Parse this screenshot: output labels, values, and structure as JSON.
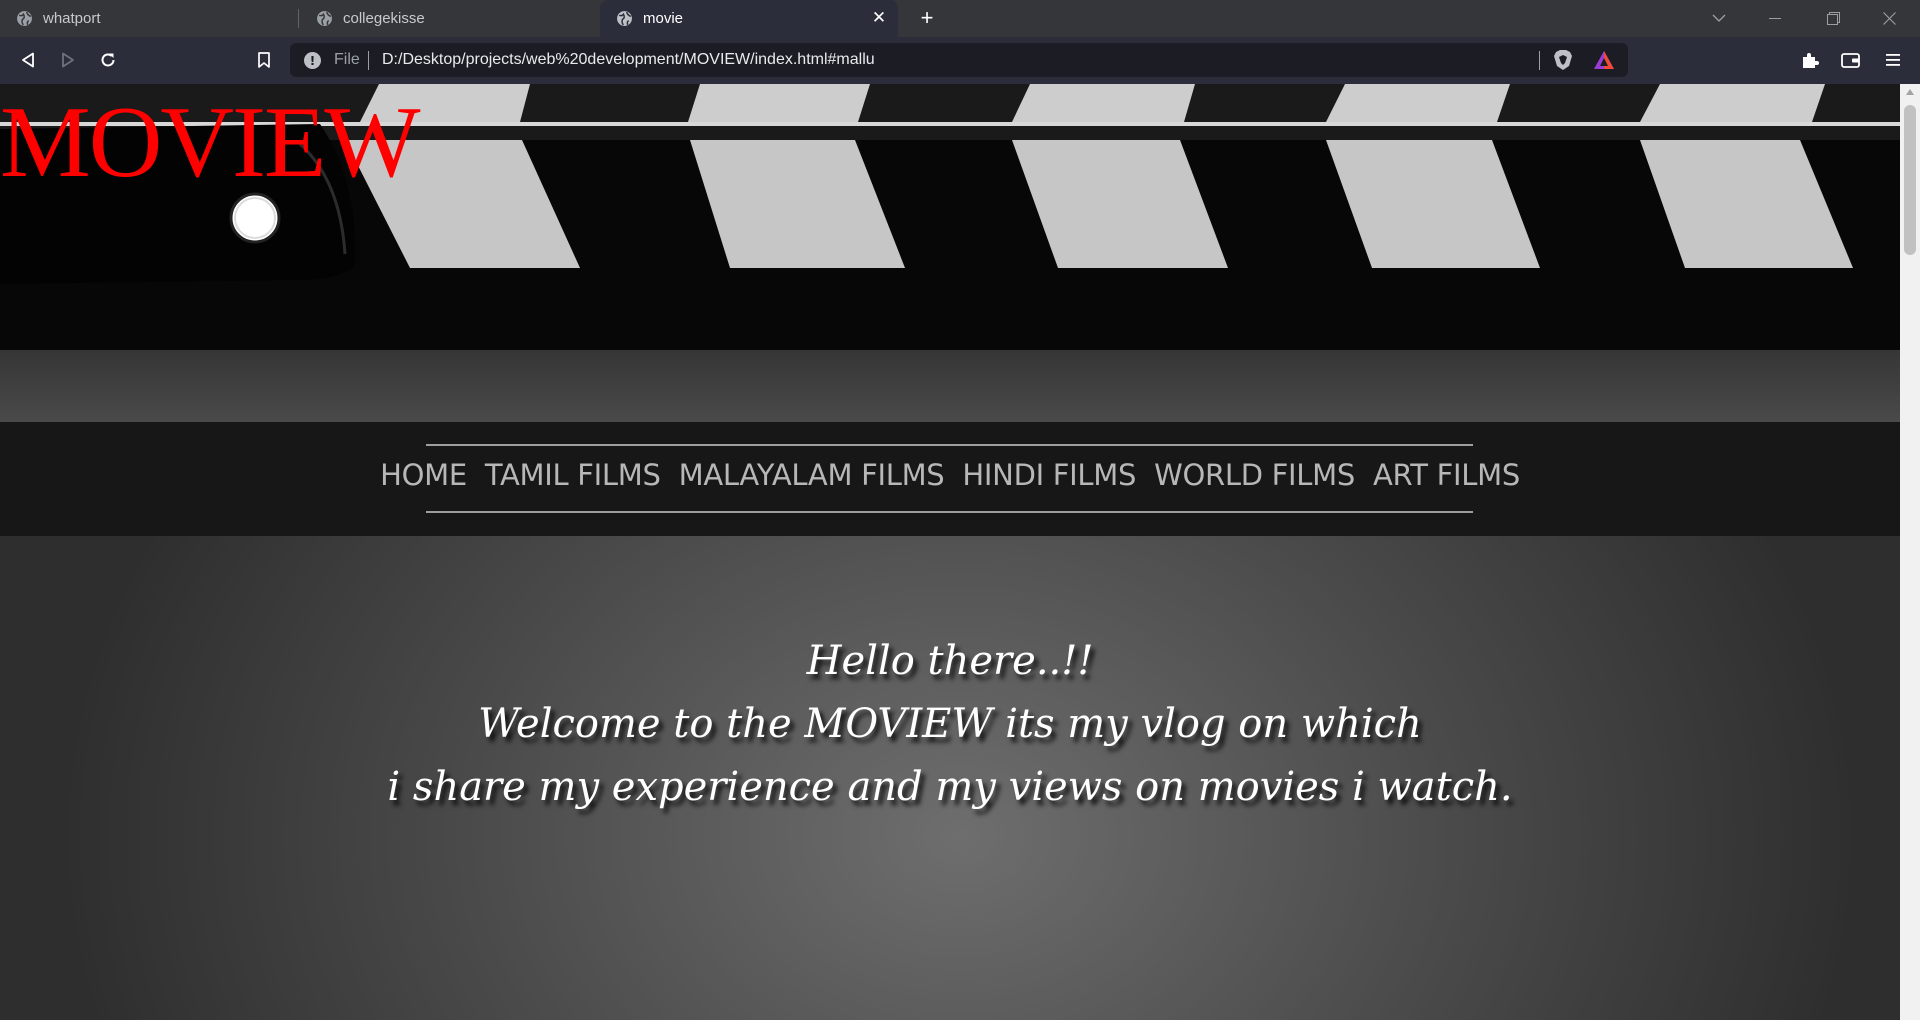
{
  "browser": {
    "tabs": [
      {
        "title": "whatport",
        "active": false
      },
      {
        "title": "collegekisse",
        "active": false
      },
      {
        "title": "movie",
        "active": true
      }
    ],
    "address": {
      "scheme_label": "File",
      "url": "D:/Desktop/projects/web%20development/MOVIEW/index.html#mallu"
    },
    "icons": [
      "globe-icon",
      "close-icon",
      "plus-icon",
      "chevron-down-icon",
      "minimize-icon",
      "restore-icon",
      "window-close-icon",
      "back-icon",
      "forward-icon",
      "reload-icon",
      "bookmark-icon",
      "info-icon",
      "brave-shield-icon",
      "brave-rewards-icon",
      "extensions-icon",
      "wallet-icon",
      "menu-icon"
    ]
  },
  "page": {
    "logo": "MOVIEW",
    "nav": [
      "HOME",
      "TAMIL FILMS",
      "MALAYALAM FILMS",
      "HINDI FILMS",
      "WORLD FILMS",
      "ART FILMS"
    ],
    "welcome": {
      "line1": "Hello there..!!",
      "line2": "Welcome to the MOVIEW its my vlog on which",
      "line3": "i share my experience and my views on movies i watch."
    },
    "colors": {
      "logo": "#ff0000",
      "nav_text": "#b7b7b7",
      "nav_bg": "#171717"
    }
  }
}
